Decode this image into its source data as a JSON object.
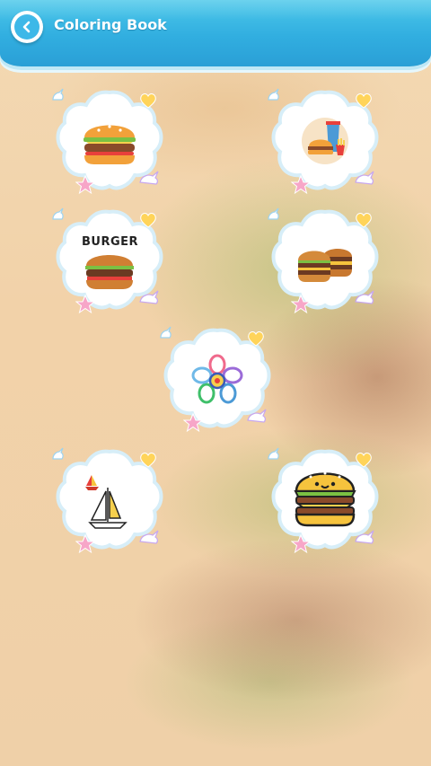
{
  "header": {
    "title": "Coloring Book",
    "back_icon": "chevron-left-icon"
  },
  "colors": {
    "header_blue": "#31aee0",
    "card_border": "#d7eef8",
    "heart": "#ffd45a",
    "star": "#f7a6c8"
  },
  "gallery": {
    "items": [
      {
        "name": "hamburger-picture",
        "caption": ""
      },
      {
        "name": "fast-food-meal-picture",
        "caption": ""
      },
      {
        "name": "burger-lettering-picture",
        "caption": "BURGER"
      },
      {
        "name": "double-burger-picture",
        "caption": ""
      },
      {
        "name": "rainbow-flower-picture",
        "caption": ""
      },
      {
        "name": "sailboat-picture",
        "caption": ""
      },
      {
        "name": "cute-burger-picture",
        "caption": ""
      }
    ]
  }
}
